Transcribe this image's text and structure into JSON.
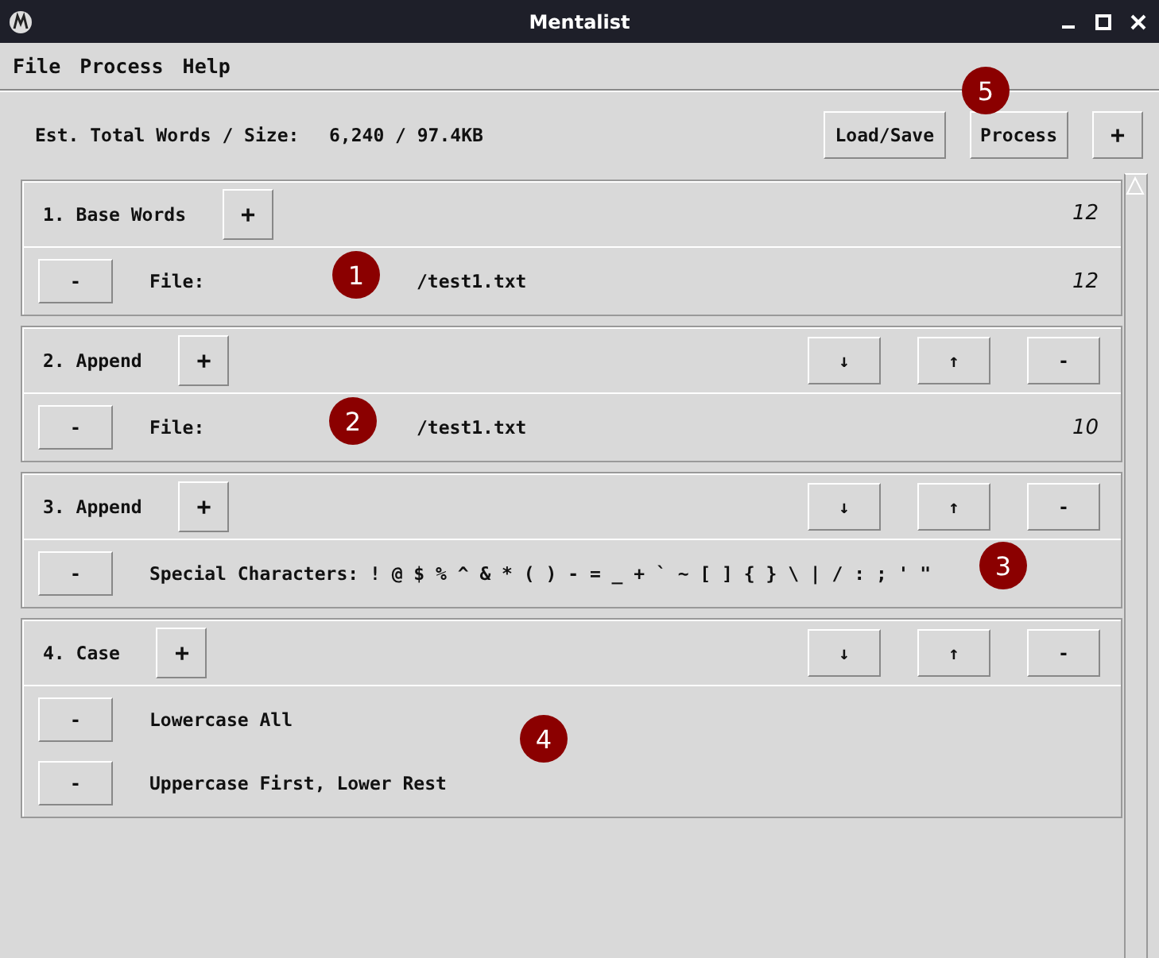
{
  "window": {
    "title": "Mentalist"
  },
  "menu": [
    "File",
    "Process",
    "Help"
  ],
  "summary": {
    "label": "Est. Total Words / Size:",
    "value": "6,240 / 97.4KB"
  },
  "toolbar": [
    "Load/Save",
    "Process",
    "+"
  ],
  "sections": [
    {
      "title": "1. Base Words",
      "add": "+",
      "count": "12",
      "rows": [
        {
          "remove": "-",
          "label": "File:",
          "value": "/test1.txt",
          "count": "12"
        }
      ]
    },
    {
      "title": "2. Append",
      "add": "+",
      "controls": [
        "↓",
        "↑",
        "-"
      ],
      "rows": [
        {
          "remove": "-",
          "label": "File:",
          "value": "/test1.txt",
          "count": "10"
        }
      ]
    },
    {
      "title": "3. Append",
      "add": "+",
      "controls": [
        "↓",
        "↑",
        "-"
      ],
      "rows": [
        {
          "remove": "-",
          "label": "Special Characters: ! @ $ % ^ & * ( ) - = _ + ` ~ [ ] { } \\ | / : ; ' \""
        }
      ]
    },
    {
      "title": "4. Case",
      "add": "+",
      "controls": [
        "↓",
        "↑",
        "-"
      ],
      "rows": [
        {
          "remove": "-",
          "label": "Lowercase All"
        },
        {
          "remove": "-",
          "label": "Uppercase First, Lower Rest"
        }
      ]
    }
  ],
  "annotations": [
    "1",
    "2",
    "3",
    "4",
    "5"
  ]
}
